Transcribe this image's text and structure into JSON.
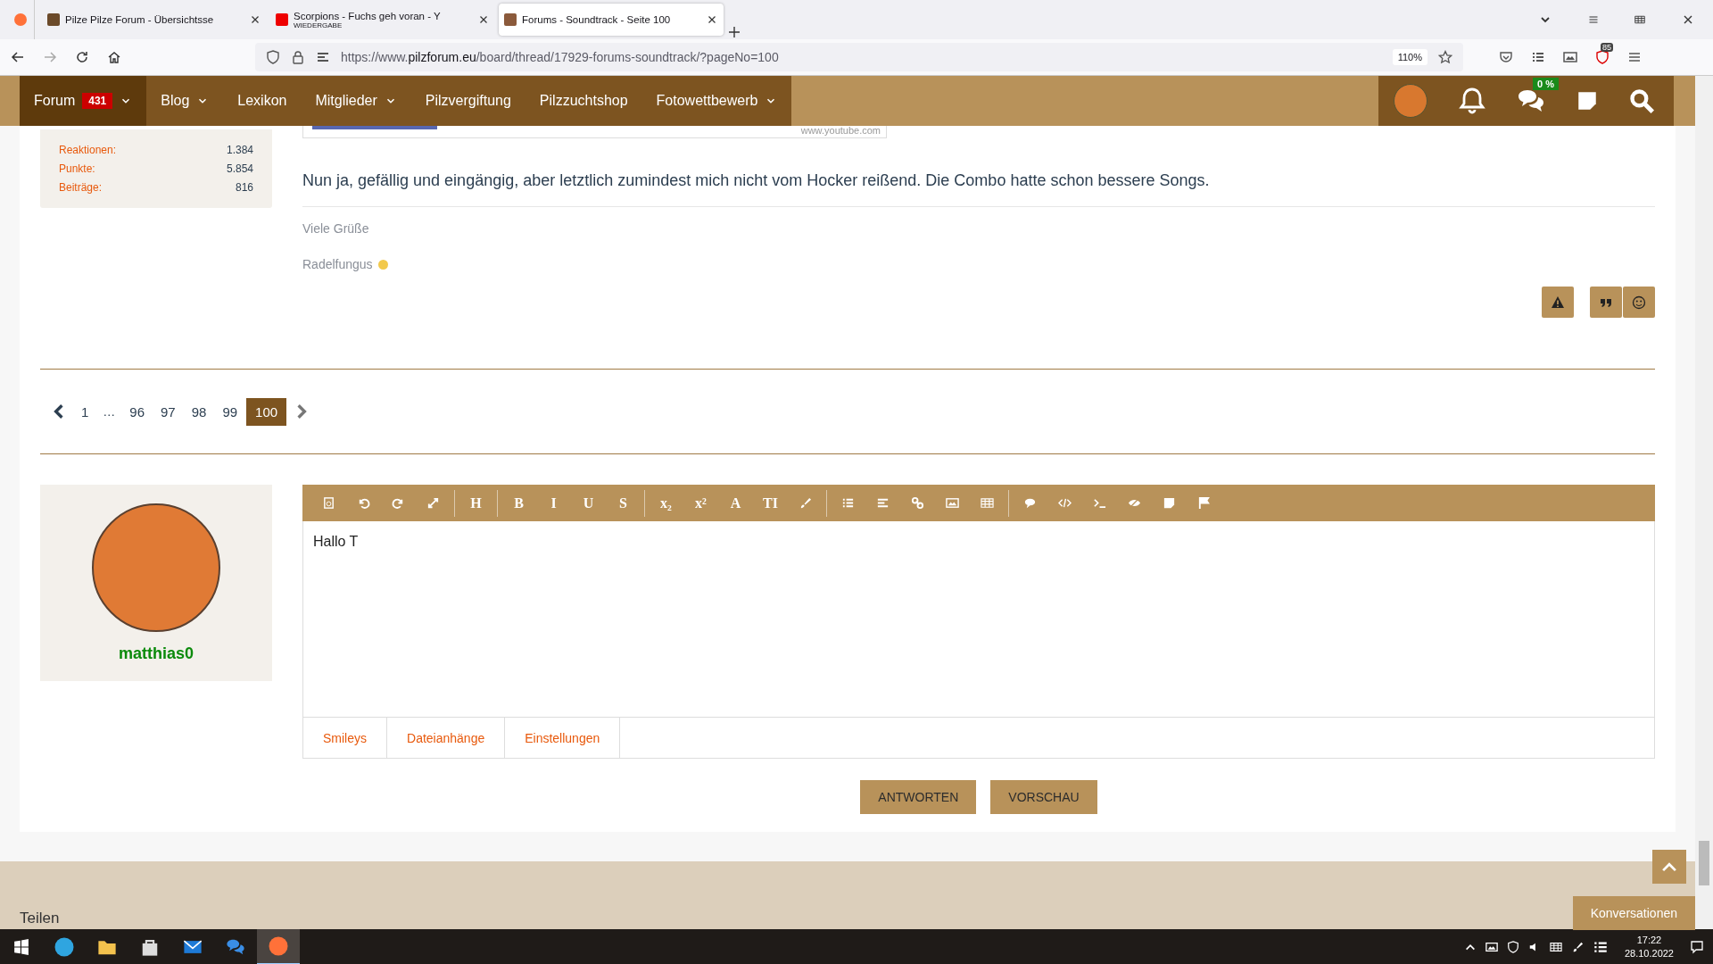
{
  "browser": {
    "tabs": [
      {
        "title": "Pilze Pilze Forum - Übersichtsse",
        "selected": false
      },
      {
        "title": "Scorpions - Fuchs geh voran - Y",
        "subtitle": "WIEDERGABE",
        "selected": false
      },
      {
        "title": "Forums - Soundtrack - Seite 100",
        "selected": true
      }
    ],
    "url_prefix": "https://www.",
    "url_domain": "pilzforum.eu",
    "url_path": "/board/thread/17929-forums-soundtrack/?pageNo=100",
    "zoom": "110%",
    "extension_badge": "85"
  },
  "nav": {
    "items": [
      {
        "label": "Forum",
        "badge": "431",
        "dropdown": true,
        "selected": true
      },
      {
        "label": "Blog",
        "dropdown": true,
        "selected": false
      },
      {
        "label": "Lexikon",
        "dropdown": false,
        "selected": false
      },
      {
        "label": "Mitglieder",
        "dropdown": true,
        "selected": false
      },
      {
        "label": "Pilzvergiftung",
        "dropdown": false,
        "selected": false
      },
      {
        "label": "Pilzzuchtshop",
        "dropdown": false,
        "selected": false
      },
      {
        "label": "Fotowettbewerb",
        "dropdown": true,
        "selected": false
      }
    ],
    "chat_badge": "0 %"
  },
  "sidebar": {
    "stats": [
      {
        "label": "Reaktionen:",
        "value": "1.384"
      },
      {
        "label": "Punkte:",
        "value": "5.854"
      },
      {
        "label": "Beiträge:",
        "value": "816"
      }
    ]
  },
  "post": {
    "embed_source": "www.youtube.com",
    "text": "Nun ja, gefällig und eingängig, aber letztlich zumindest mich nicht vom Hocker reißend. Die Combo hatte schon bessere Songs.",
    "signature": [
      "Viele Grüße",
      "Radelfungus"
    ]
  },
  "pagination": [
    {
      "kind": "page",
      "label": "1",
      "selected": false
    },
    {
      "kind": "ellipsis",
      "label": "…"
    },
    {
      "kind": "page",
      "label": "96",
      "selected": false
    },
    {
      "kind": "page",
      "label": "97",
      "selected": false
    },
    {
      "kind": "page",
      "label": "98",
      "selected": false
    },
    {
      "kind": "page",
      "label": "99",
      "selected": false
    },
    {
      "kind": "page",
      "label": "100",
      "selected": true
    }
  ],
  "reply": {
    "username": "matthias0",
    "value": "Hallo T",
    "toolbar": [
      [
        {
          "kind": "source"
        },
        {
          "kind": "undo"
        },
        {
          "kind": "redo"
        },
        {
          "kind": "fullscreen"
        }
      ],
      [
        {
          "kind": "letter",
          "label": "H"
        }
      ],
      [
        {
          "kind": "letter",
          "label": "B"
        },
        {
          "kind": "letter",
          "label": "I"
        },
        {
          "kind": "letter",
          "label": "U"
        },
        {
          "kind": "letter",
          "label": "S"
        }
      ],
      [
        {
          "kind": "letter",
          "label": "x₂"
        },
        {
          "kind": "letter",
          "label": "x²"
        },
        {
          "kind": "letter",
          "label": "A"
        },
        {
          "kind": "letter",
          "label": "TI"
        },
        {
          "kind": "brush"
        }
      ],
      [
        {
          "kind": "list"
        },
        {
          "kind": "align"
        },
        {
          "kind": "link"
        },
        {
          "kind": "image"
        },
        {
          "kind": "table"
        }
      ],
      [
        {
          "kind": "speech"
        },
        {
          "kind": "code"
        },
        {
          "kind": "terminal"
        },
        {
          "kind": "spoiler"
        },
        {
          "kind": "note"
        },
        {
          "kind": "flag"
        }
      ]
    ],
    "tabs": [
      "Smileys",
      "Dateianhänge",
      "Einstellungen"
    ],
    "buttons": [
      "ANTWORTEN",
      "VORSCHAU"
    ]
  },
  "footer": {
    "heading": "Teilen",
    "conversations": "Konversationen"
  },
  "taskbar": {
    "time": "17:22",
    "date": "28.10.2022"
  }
}
